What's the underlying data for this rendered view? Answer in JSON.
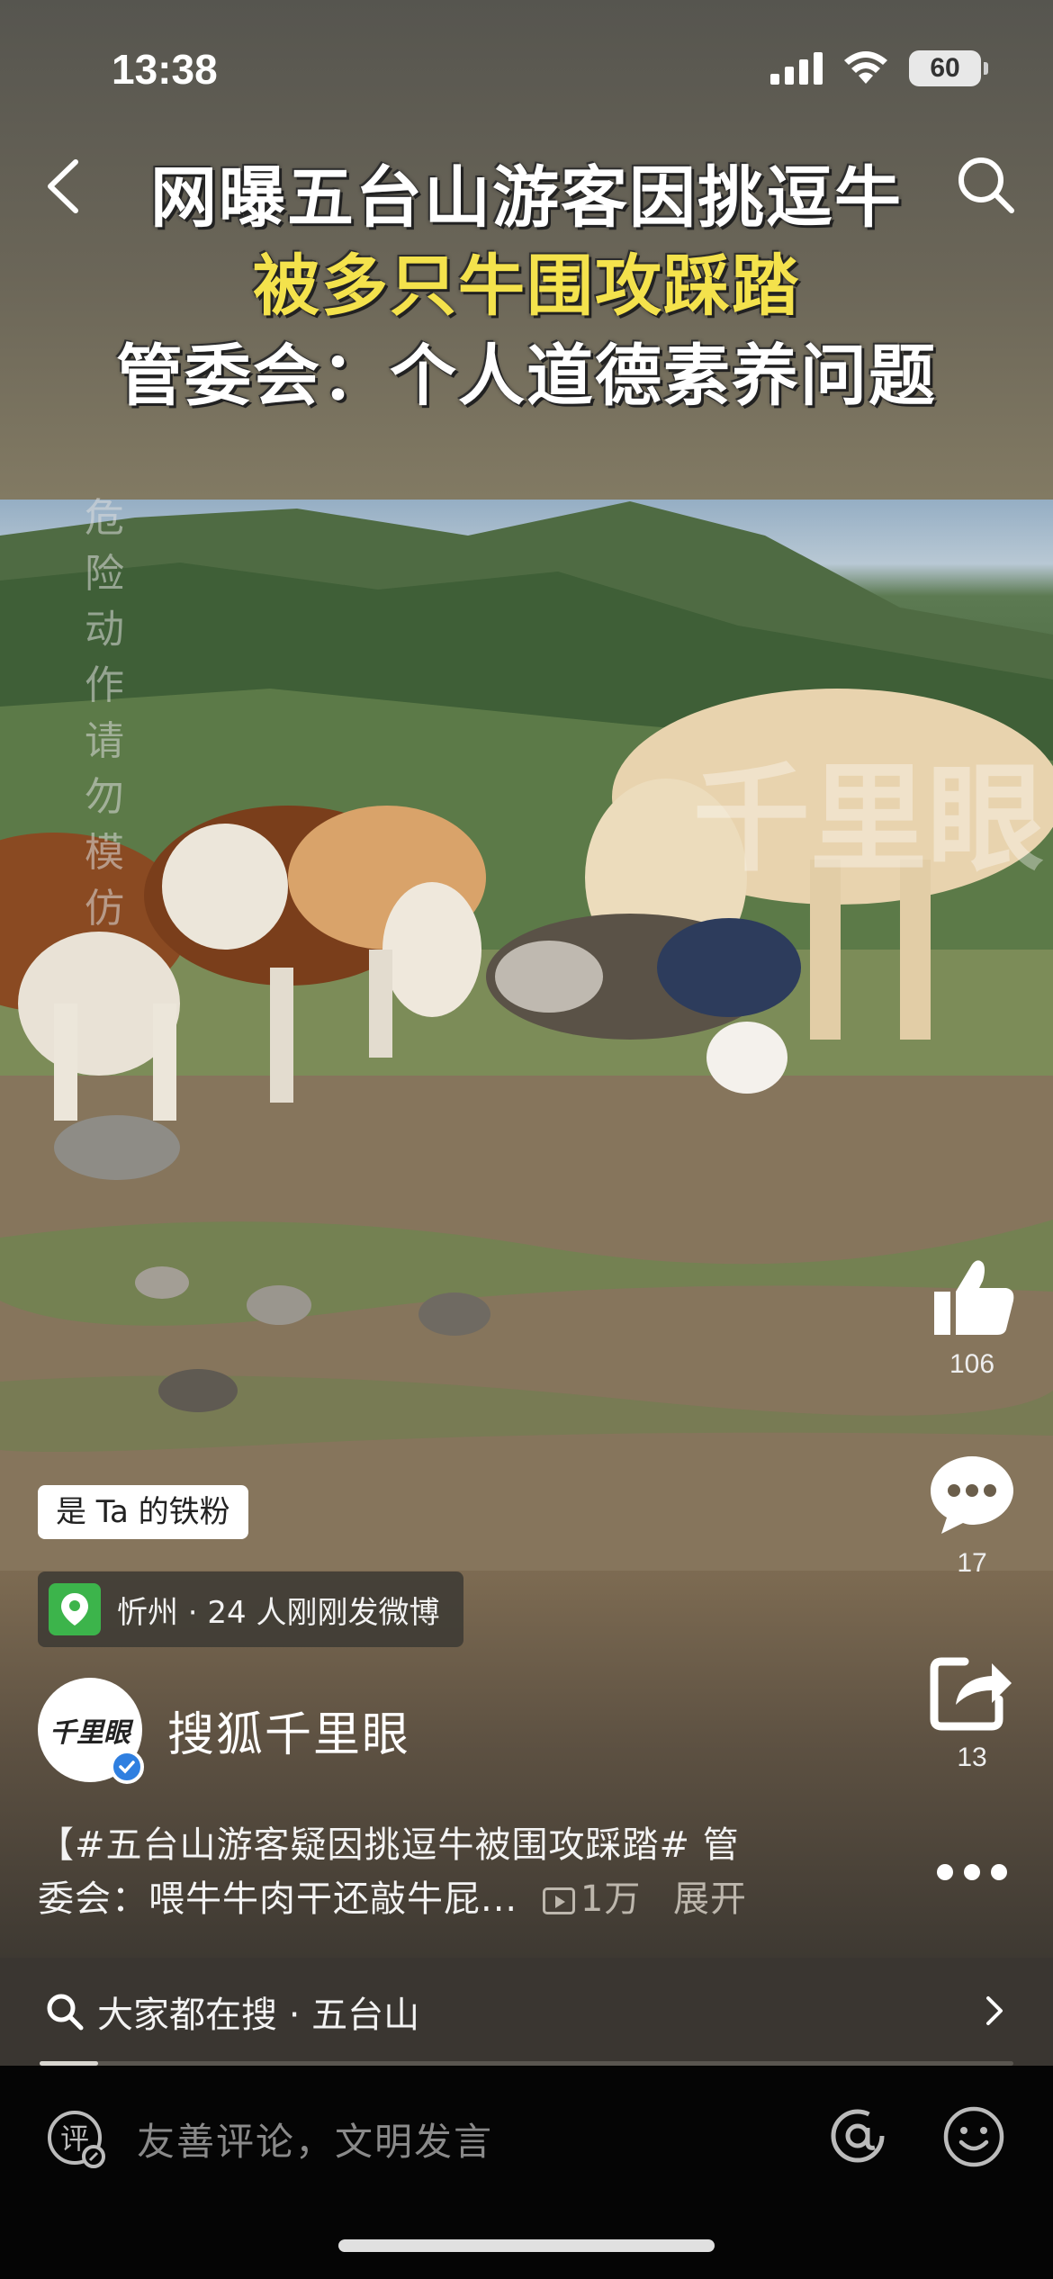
{
  "status_bar": {
    "time": "13:38",
    "battery": "60"
  },
  "headline": {
    "line1": "网曝五台山游客因挑逗牛",
    "line2": "被多只牛围攻踩踏",
    "line3": "管委会：个人道德素养问题"
  },
  "video": {
    "warning": "危险动作 请勿模仿",
    "watermark": "千里眼"
  },
  "actions": {
    "likes": "106",
    "comments": "17",
    "shares": "13"
  },
  "fan_badge": "是 Ta 的铁粉",
  "location": "忻州 · 24 人刚刚发微博",
  "author": {
    "name": "搜狐千里眼",
    "avatar_text": "千里眼"
  },
  "caption": {
    "line1": "【#五台山游客疑因挑逗牛被围攻踩踏# 管",
    "line2": "委会：喂牛牛肉干还敲牛屁...",
    "views": "1万",
    "expand": "展开"
  },
  "hot_search": {
    "label": "大家都在搜 · 五台山",
    "progress_fraction": 0.06
  },
  "comment_input": {
    "placeholder": "友善评论，文明发言",
    "icon_text": "评"
  },
  "colors": {
    "headline_yellow": "#f4e24c",
    "location_green": "#3cb44b",
    "verified_blue": "#2f7fe0"
  }
}
